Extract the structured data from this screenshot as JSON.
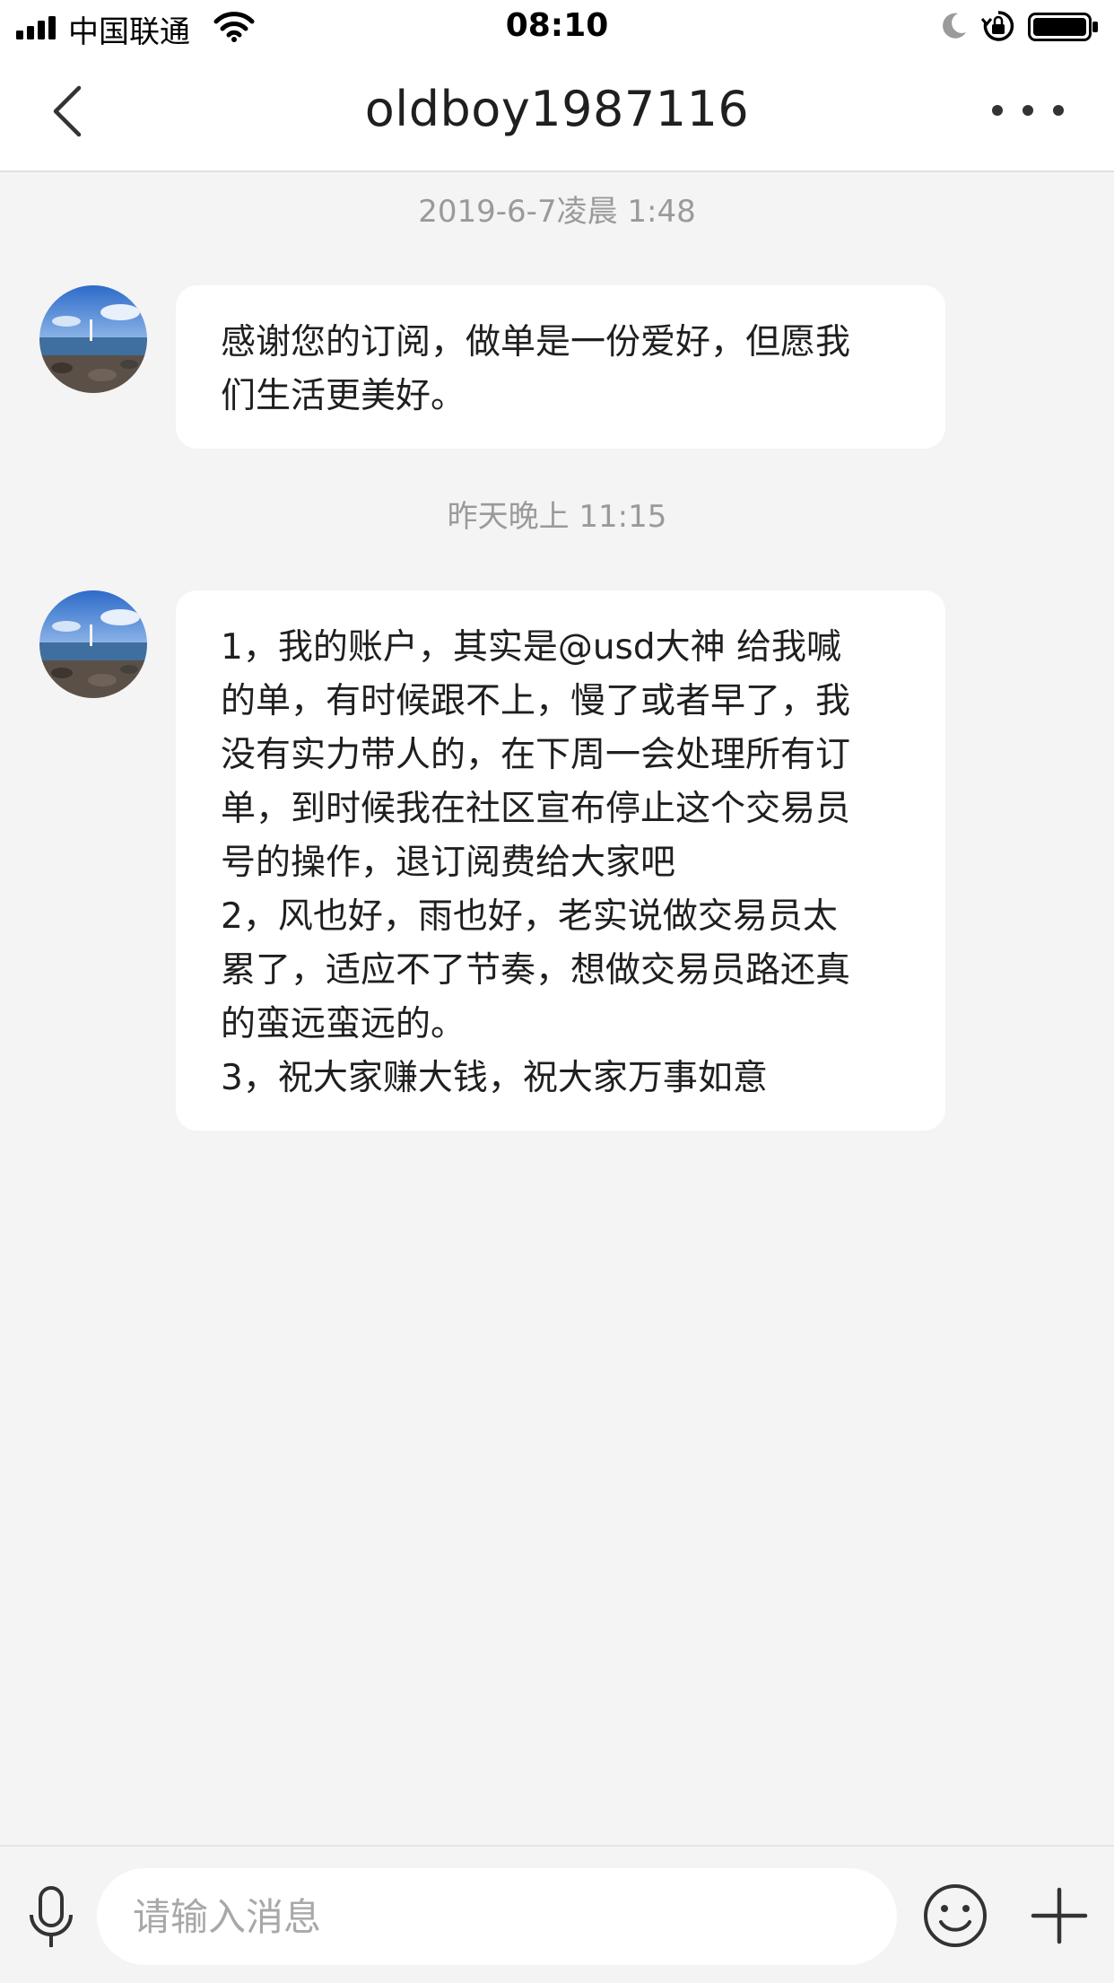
{
  "status_bar": {
    "carrier": "中国联通",
    "time": "08:10"
  },
  "nav": {
    "title": "oldboy1987116"
  },
  "messages": [
    {
      "timestamp": "2019-6-7凌晨 1:48",
      "lines": [
        "感谢您的订阅，做单是一份爱好，但愿我",
        "们生活更美好。"
      ]
    },
    {
      "timestamp": "昨天晚上 11:15",
      "lines": [
        "1，我的账户，其实是@usd大神 给我喊",
        "的单，有时候跟不上，慢了或者早了，我",
        "没有实力带人的，在下周一会处理所有订",
        "单，到时候我在社区宣布停止这个交易员",
        "号的操作，退订阅费给大家吧",
        "2，风也好，雨也好，老实说做交易员太",
        "累了，适应不了节奏，想做交易员路还真",
        "的蛮远蛮远的。",
        "3，祝大家赚大钱，祝大家万事如意"
      ]
    }
  ],
  "input": {
    "placeholder": "请输入消息",
    "value": ""
  },
  "icons": {
    "back": "chevron-left-icon",
    "more": "more-dots-icon",
    "mic": "microphone-icon",
    "emoji": "emoji-icon",
    "plus": "plus-icon"
  },
  "colors": {
    "background": "#f4f4f5",
    "bubble": "#ffffff",
    "timestamp": "#9a9a9a",
    "text": "#1f1f1f"
  }
}
